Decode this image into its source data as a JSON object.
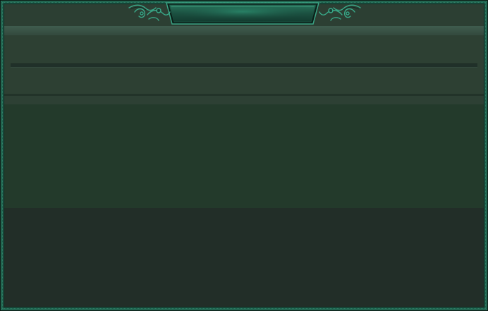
{
  "window": {
    "title": ""
  },
  "theme": {
    "frame_color": "#1d5a47",
    "accent_color": "#3d9e80",
    "panel_color": "#2c3f33",
    "lower_panel_color": "#222e28"
  },
  "icons": {
    "left_ornament": "scroll-ornament-icon",
    "right_ornament": "scroll-ornament-icon"
  }
}
